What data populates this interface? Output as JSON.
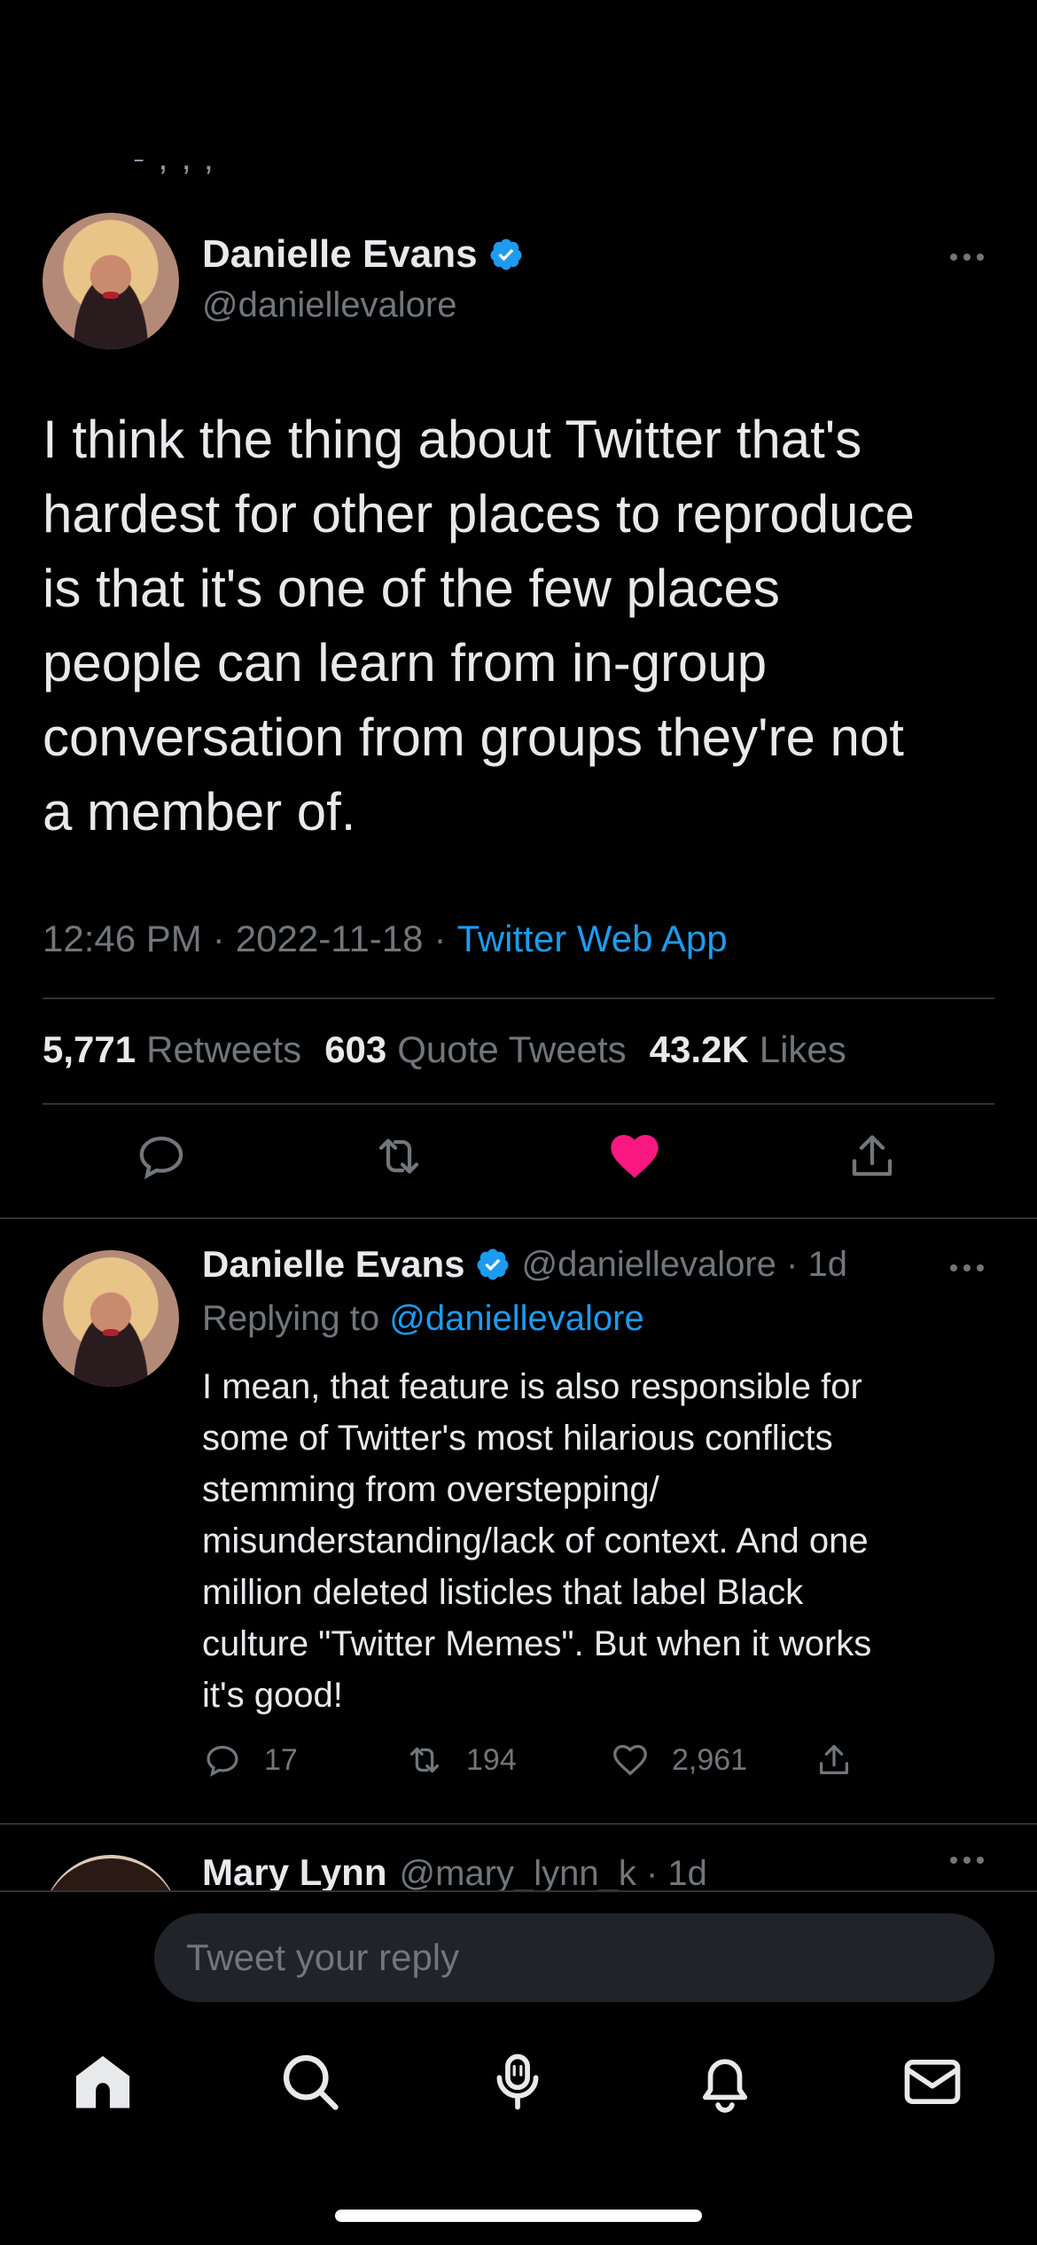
{
  "main_tweet": {
    "author": "Danielle Evans",
    "handle": "@daniellevalore",
    "text": "I think the thing about Twitter that's\nhardest for other places to reproduce\nis that it's one of the few places\npeople can learn from in-group\nconversation from groups they're not\na member of.",
    "time": "12:46 PM",
    "date": "2022-11-18",
    "source": "Twitter Web App",
    "separator": "·",
    "stats": {
      "retweets_count": "5,771",
      "retweets_label": "Retweets",
      "quotes_count": "603",
      "quotes_label": "Quote Tweets",
      "likes_count": "43.2K",
      "likes_label": "Likes"
    },
    "liked": true
  },
  "reply_tweet": {
    "author": "Danielle Evans",
    "handle": "@daniellevalore · 1d",
    "replying_prefix": "Replying to",
    "replying_to": "@daniellevalore",
    "text": "I mean, that feature is also responsible for\nsome of Twitter's most hilarious conflicts\nstemming from overstepping/\nmisunderstanding/lack of context. And one\nmillion deleted listicles that label Black\nculture \"Twitter Memes\". But when it works\nit's good!",
    "replies": "17",
    "retweets": "194",
    "likes": "2,961"
  },
  "next_tweet": {
    "author": "Mary Lynn",
    "handle": "@mary_lynn_k · 1d"
  },
  "reply_bar": {
    "placeholder": "Tweet your reply"
  },
  "tabs": [
    "home-icon",
    "search-icon",
    "spaces-icon",
    "notifications-icon",
    "messages-icon"
  ],
  "colors": {
    "accent": "#1d9bf0",
    "like": "#f91880",
    "muted": "#71767b",
    "background": "#000000"
  }
}
